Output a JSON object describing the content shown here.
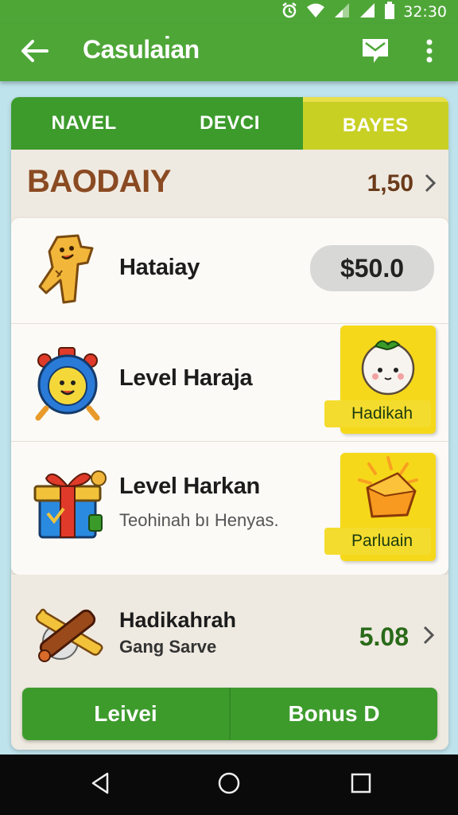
{
  "status_bar": {
    "time": "32:30"
  },
  "app_bar": {
    "title": "Casulaı̇an"
  },
  "tabs": [
    {
      "label": "NAVEL",
      "active": false
    },
    {
      "label": "DEVCI",
      "active": false
    },
    {
      "label": "BAYES",
      "active": true
    }
  ],
  "section": {
    "title": "BAODAIY",
    "value": "1,50"
  },
  "items": [
    {
      "title": "Hataiay",
      "price": "$50.0"
    },
    {
      "title": "Level Haraja",
      "reward_label": "Hadikah"
    },
    {
      "title": "Level Harkan",
      "subtitle": "Teohinah bı Henyas.",
      "reward_label": "Parluain"
    }
  ],
  "bottom_item": {
    "title": "Hadikahrah",
    "subtitle": "Gang Sarve",
    "value": "5.08"
  },
  "actions": {
    "left": "Leivei",
    "right": "Bonus D"
  },
  "colors": {
    "primary_green": "#4ea637",
    "tab_active": "#c8d024",
    "reward_yellow": "#f6d81a",
    "title_brown": "#8a4a22"
  },
  "icons": [
    "back-arrow-icon",
    "message-icon",
    "more-vert-icon",
    "wifi-icon",
    "signal-icon",
    "battery-icon",
    "alarm-icon",
    "nav-back-icon",
    "nav-home-icon",
    "nav-recents-icon"
  ]
}
